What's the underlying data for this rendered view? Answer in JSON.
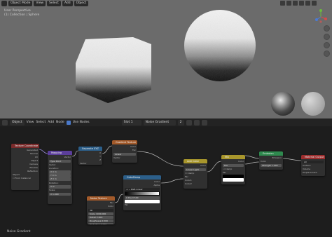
{
  "viewport": {
    "header": {
      "mode": "Object Mode",
      "menus": [
        "View",
        "Select",
        "Add",
        "Object"
      ]
    },
    "info": {
      "view_name": "User Perspective",
      "collection": "(1) Collection | Sphere"
    }
  },
  "node_editor": {
    "header": {
      "editor_type": "Object",
      "menus": [
        "View",
        "Select",
        "Add",
        "Node"
      ],
      "use_nodes": "Use Nodes",
      "slot": "Slot 1",
      "material": "Noise Gradient",
      "user_count": "2"
    },
    "status": "Noise Gradient",
    "colors": {
      "input_header": "#7a2a2a",
      "vector_header": "#5b3e9a",
      "converter_header": "#2c5f8a",
      "texture_header": "#a35a2a",
      "color_header": "#a8962c",
      "shader_header": "#2e8a4e",
      "output_header": "#9c2d2d"
    }
  }
}
